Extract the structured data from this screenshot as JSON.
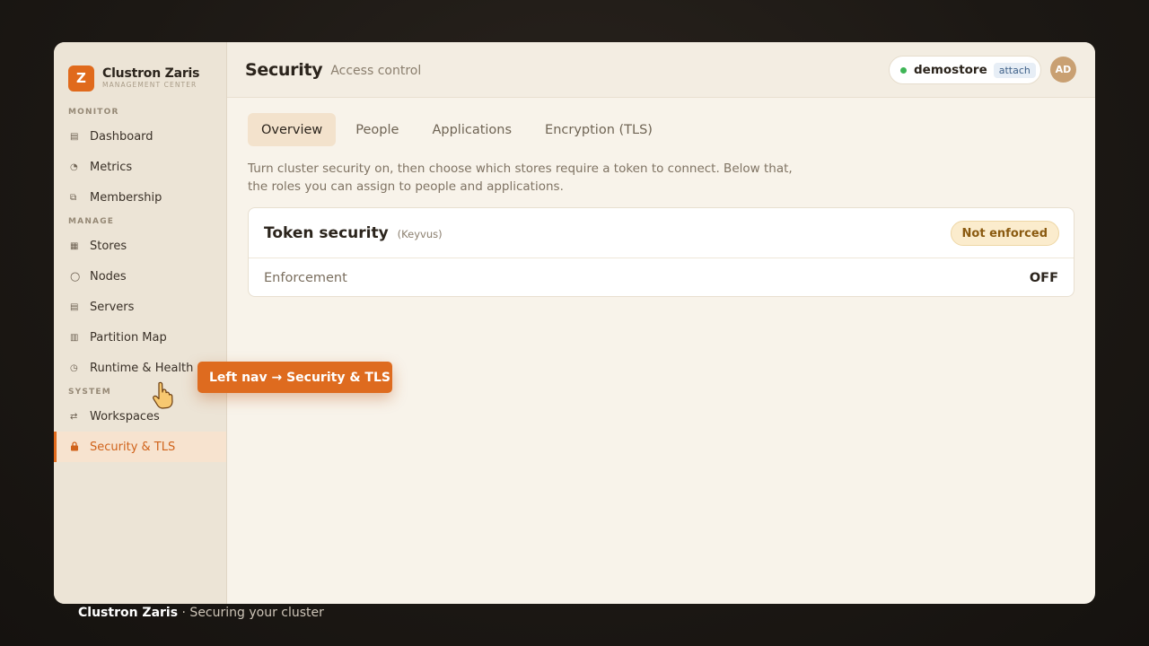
{
  "brand": {
    "logo_letter": "Z",
    "name": "Clustron Zaris",
    "subtitle": "MANAGEMENT CENTER"
  },
  "sidebar": {
    "sections": [
      {
        "label": "MONITOR",
        "items": [
          {
            "label": "Dashboard",
            "icon": "list-icon"
          },
          {
            "label": "Metrics",
            "icon": "gauge-icon"
          },
          {
            "label": "Membership",
            "icon": "nodes-icon"
          }
        ]
      },
      {
        "label": "MANAGE",
        "items": [
          {
            "label": "Stores",
            "icon": "grid-icon"
          },
          {
            "label": "Nodes",
            "icon": "circle-icon"
          },
          {
            "label": "Servers",
            "icon": "server-icon"
          },
          {
            "label": "Partition Map",
            "icon": "map-icon"
          },
          {
            "label": "Runtime & Health",
            "icon": "clock-icon"
          }
        ]
      },
      {
        "label": "SYSTEM",
        "items": [
          {
            "label": "Workspaces",
            "icon": "swap-icon"
          },
          {
            "label": "Security & TLS",
            "icon": "lock-icon",
            "active": true
          }
        ]
      }
    ]
  },
  "header": {
    "title": "Security",
    "subtitle": "Access control",
    "store": {
      "name": "demostore",
      "status": "connected",
      "attach_label": "attach"
    },
    "avatar_initials": "AD"
  },
  "tabs": [
    {
      "label": "Overview",
      "active": true
    },
    {
      "label": "People"
    },
    {
      "label": "Applications"
    },
    {
      "label": "Encryption (TLS)"
    }
  ],
  "description": "Turn cluster security on, then choose which stores require a token to connect. Below that, the roles you can assign to people and applications.",
  "token_card": {
    "title": "Token security",
    "tag": "(Keyvus)",
    "status": "Not enforced",
    "row_label": "Enforcement",
    "row_value": "OFF"
  },
  "callout": "Left nav → Security & TLS",
  "footer": {
    "brand": "Clustron Zaris",
    "caption": "· Securing your cluster"
  },
  "colors": {
    "accent": "#e06a1c",
    "status_ok": "#3eb556",
    "badge_warn": "#8a5a10"
  }
}
